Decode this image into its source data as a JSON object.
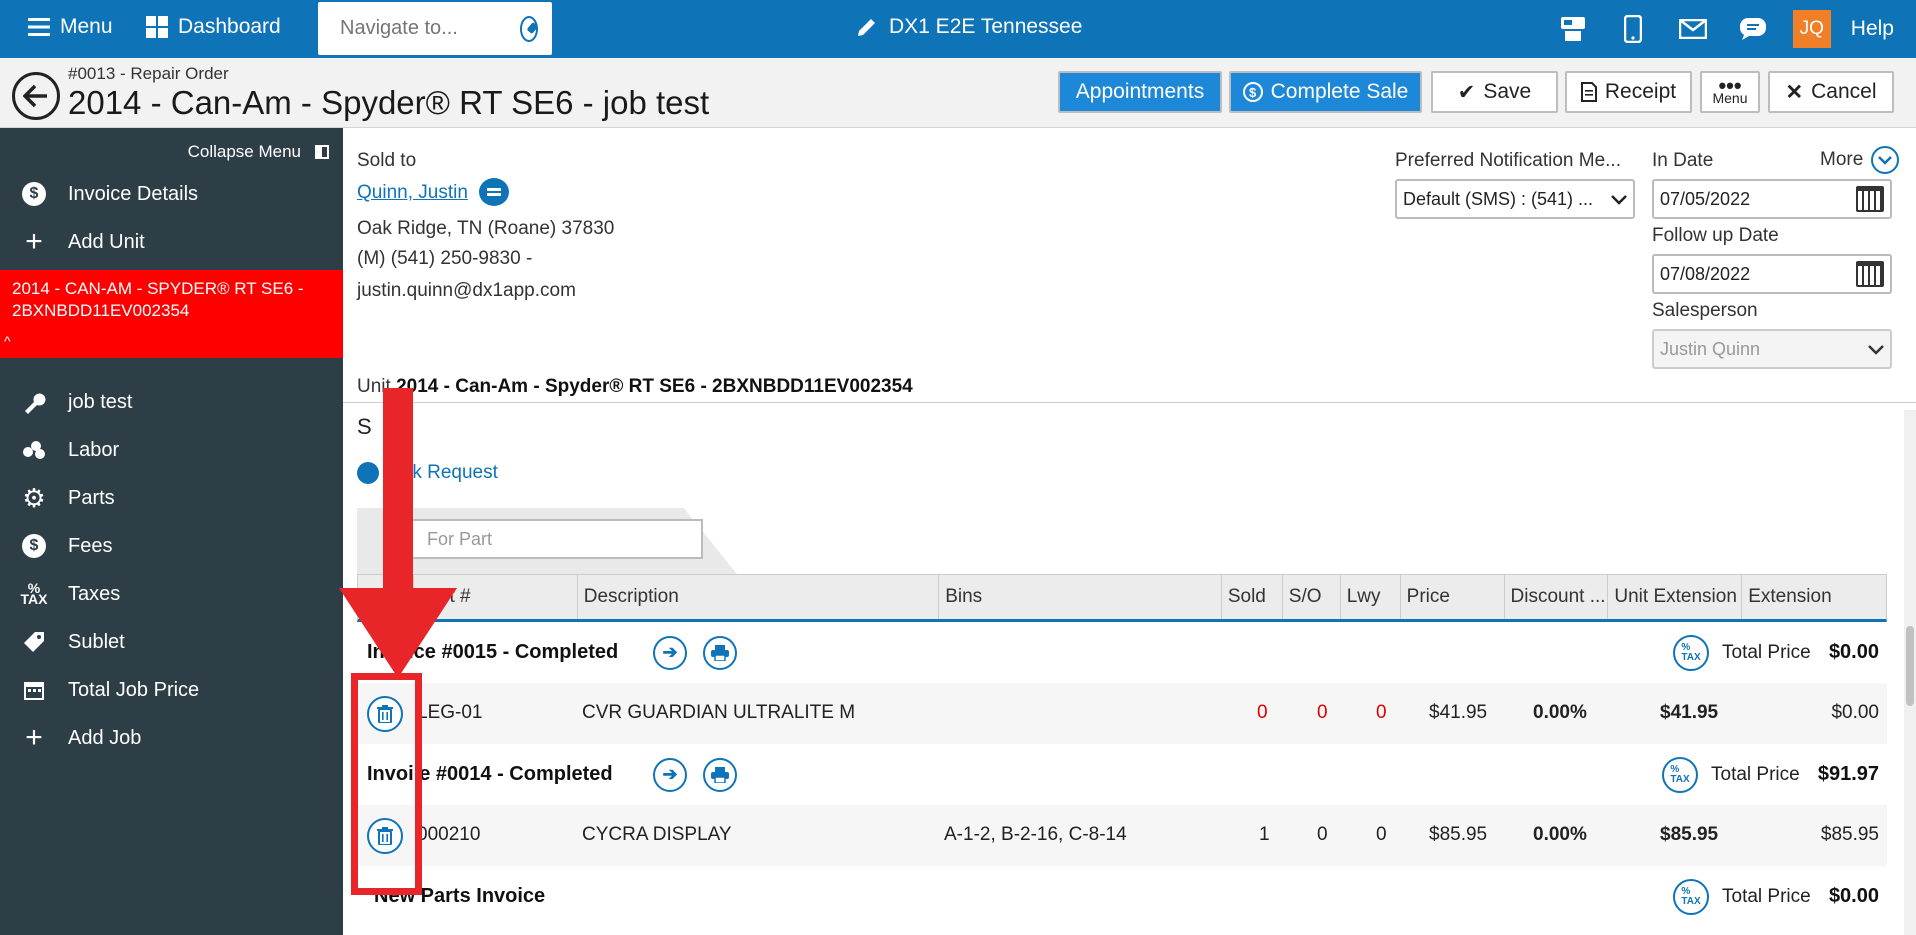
{
  "topbar": {
    "menu_label": "Menu",
    "dashboard_label": "Dashboard",
    "navigate_placeholder": "Navigate to...",
    "store_name": "DX1 E2E Tennessee",
    "user_initials": "JQ",
    "help_label": "Help"
  },
  "header": {
    "ro_label": "#0013 - Repair Order",
    "title": "2014 - Can-Am - Spyder® RT SE6 - job test",
    "buttons": {
      "appointments": "Appointments",
      "complete_sale": "Complete Sale",
      "save": "Save",
      "receipt": "Receipt",
      "menu": "Menu",
      "cancel": "Cancel"
    }
  },
  "sidebar": {
    "collapse_label": "Collapse Menu",
    "invoice_details": "Invoice Details",
    "add_unit": "Add Unit",
    "unit_selected": "2014 - CAN-AM - SPYDER® RT SE6 - 2BXNBDD11EV002354",
    "items": [
      "job test",
      "Labor",
      "Parts",
      "Fees",
      "Taxes",
      "Sublet",
      "Total Job Price",
      "Add Job"
    ]
  },
  "customer": {
    "sold_to_label": "Sold to",
    "name": "Quinn, Justin",
    "address": "Oak Ridge, TN (Roane) 37830",
    "phone": "(M) (541) 250-9830 -",
    "email": "justin.quinn@dx1app.com"
  },
  "fields": {
    "notification_label": "Preferred Notification Me...",
    "notification_value": "Default (SMS) : (541) ...",
    "in_date_label": "In Date",
    "in_date_value": "07/05/2022",
    "follow_up_label": "Follow up Date",
    "follow_up_value": "07/08/2022",
    "salesperson_label": "Salesperson",
    "salesperson_value": "Justin Quinn",
    "more_label": "More"
  },
  "unit_line": {
    "prefix": "Unit ",
    "value": "2014 - Can-Am - Spyder® RT SE6 - 2BXNBDD11EV002354"
  },
  "parts_section": {
    "title": "S",
    "blank_request": "lank Request",
    "search_placeholder": "For Part"
  },
  "table": {
    "columns": [
      "Part #",
      "Description",
      "Bins",
      "Sold",
      "S/O",
      "Lwy",
      "Price",
      "Discount ...",
      "Unit Extension",
      "Extension"
    ],
    "invoices": [
      {
        "title": "Invoice #0015 - Completed",
        "total_label": "Total Price",
        "total_value": "$0.00",
        "rows": [
          {
            "part": "LEG-01",
            "description": "CVR GUARDIAN ULTRALITE M",
            "bins": "",
            "sold": "0",
            "so": "0",
            "lwy": "0",
            "price": "$41.95",
            "discount": "0.00%",
            "unit_ext": "$41.95",
            "extension": "$0.00"
          }
        ]
      },
      {
        "title": "Invoi e #0014 - Completed",
        "total_label": "Total Price",
        "total_value": "$91.97",
        "rows": [
          {
            "part": "000210",
            "description": "CYCRA DISPLAY",
            "bins": "A-1-2, B-2-16, C-8-14",
            "sold": "1",
            "so": "0",
            "lwy": "0",
            "price": "$85.95",
            "discount": "0.00%",
            "unit_ext": "$85.95",
            "extension": "$85.95"
          }
        ]
      },
      {
        "title": "New Parts Invoice",
        "total_label": "Total Price",
        "total_value": "$0.00",
        "rows": []
      }
    ]
  },
  "colors": {
    "brand_blue": "#0f73b8",
    "sidebar_bg": "#2d3e47",
    "selected_unit_bg": "#ff0000",
    "annotation_red": "#e8262a",
    "zero_qty_red": "#e00000"
  }
}
